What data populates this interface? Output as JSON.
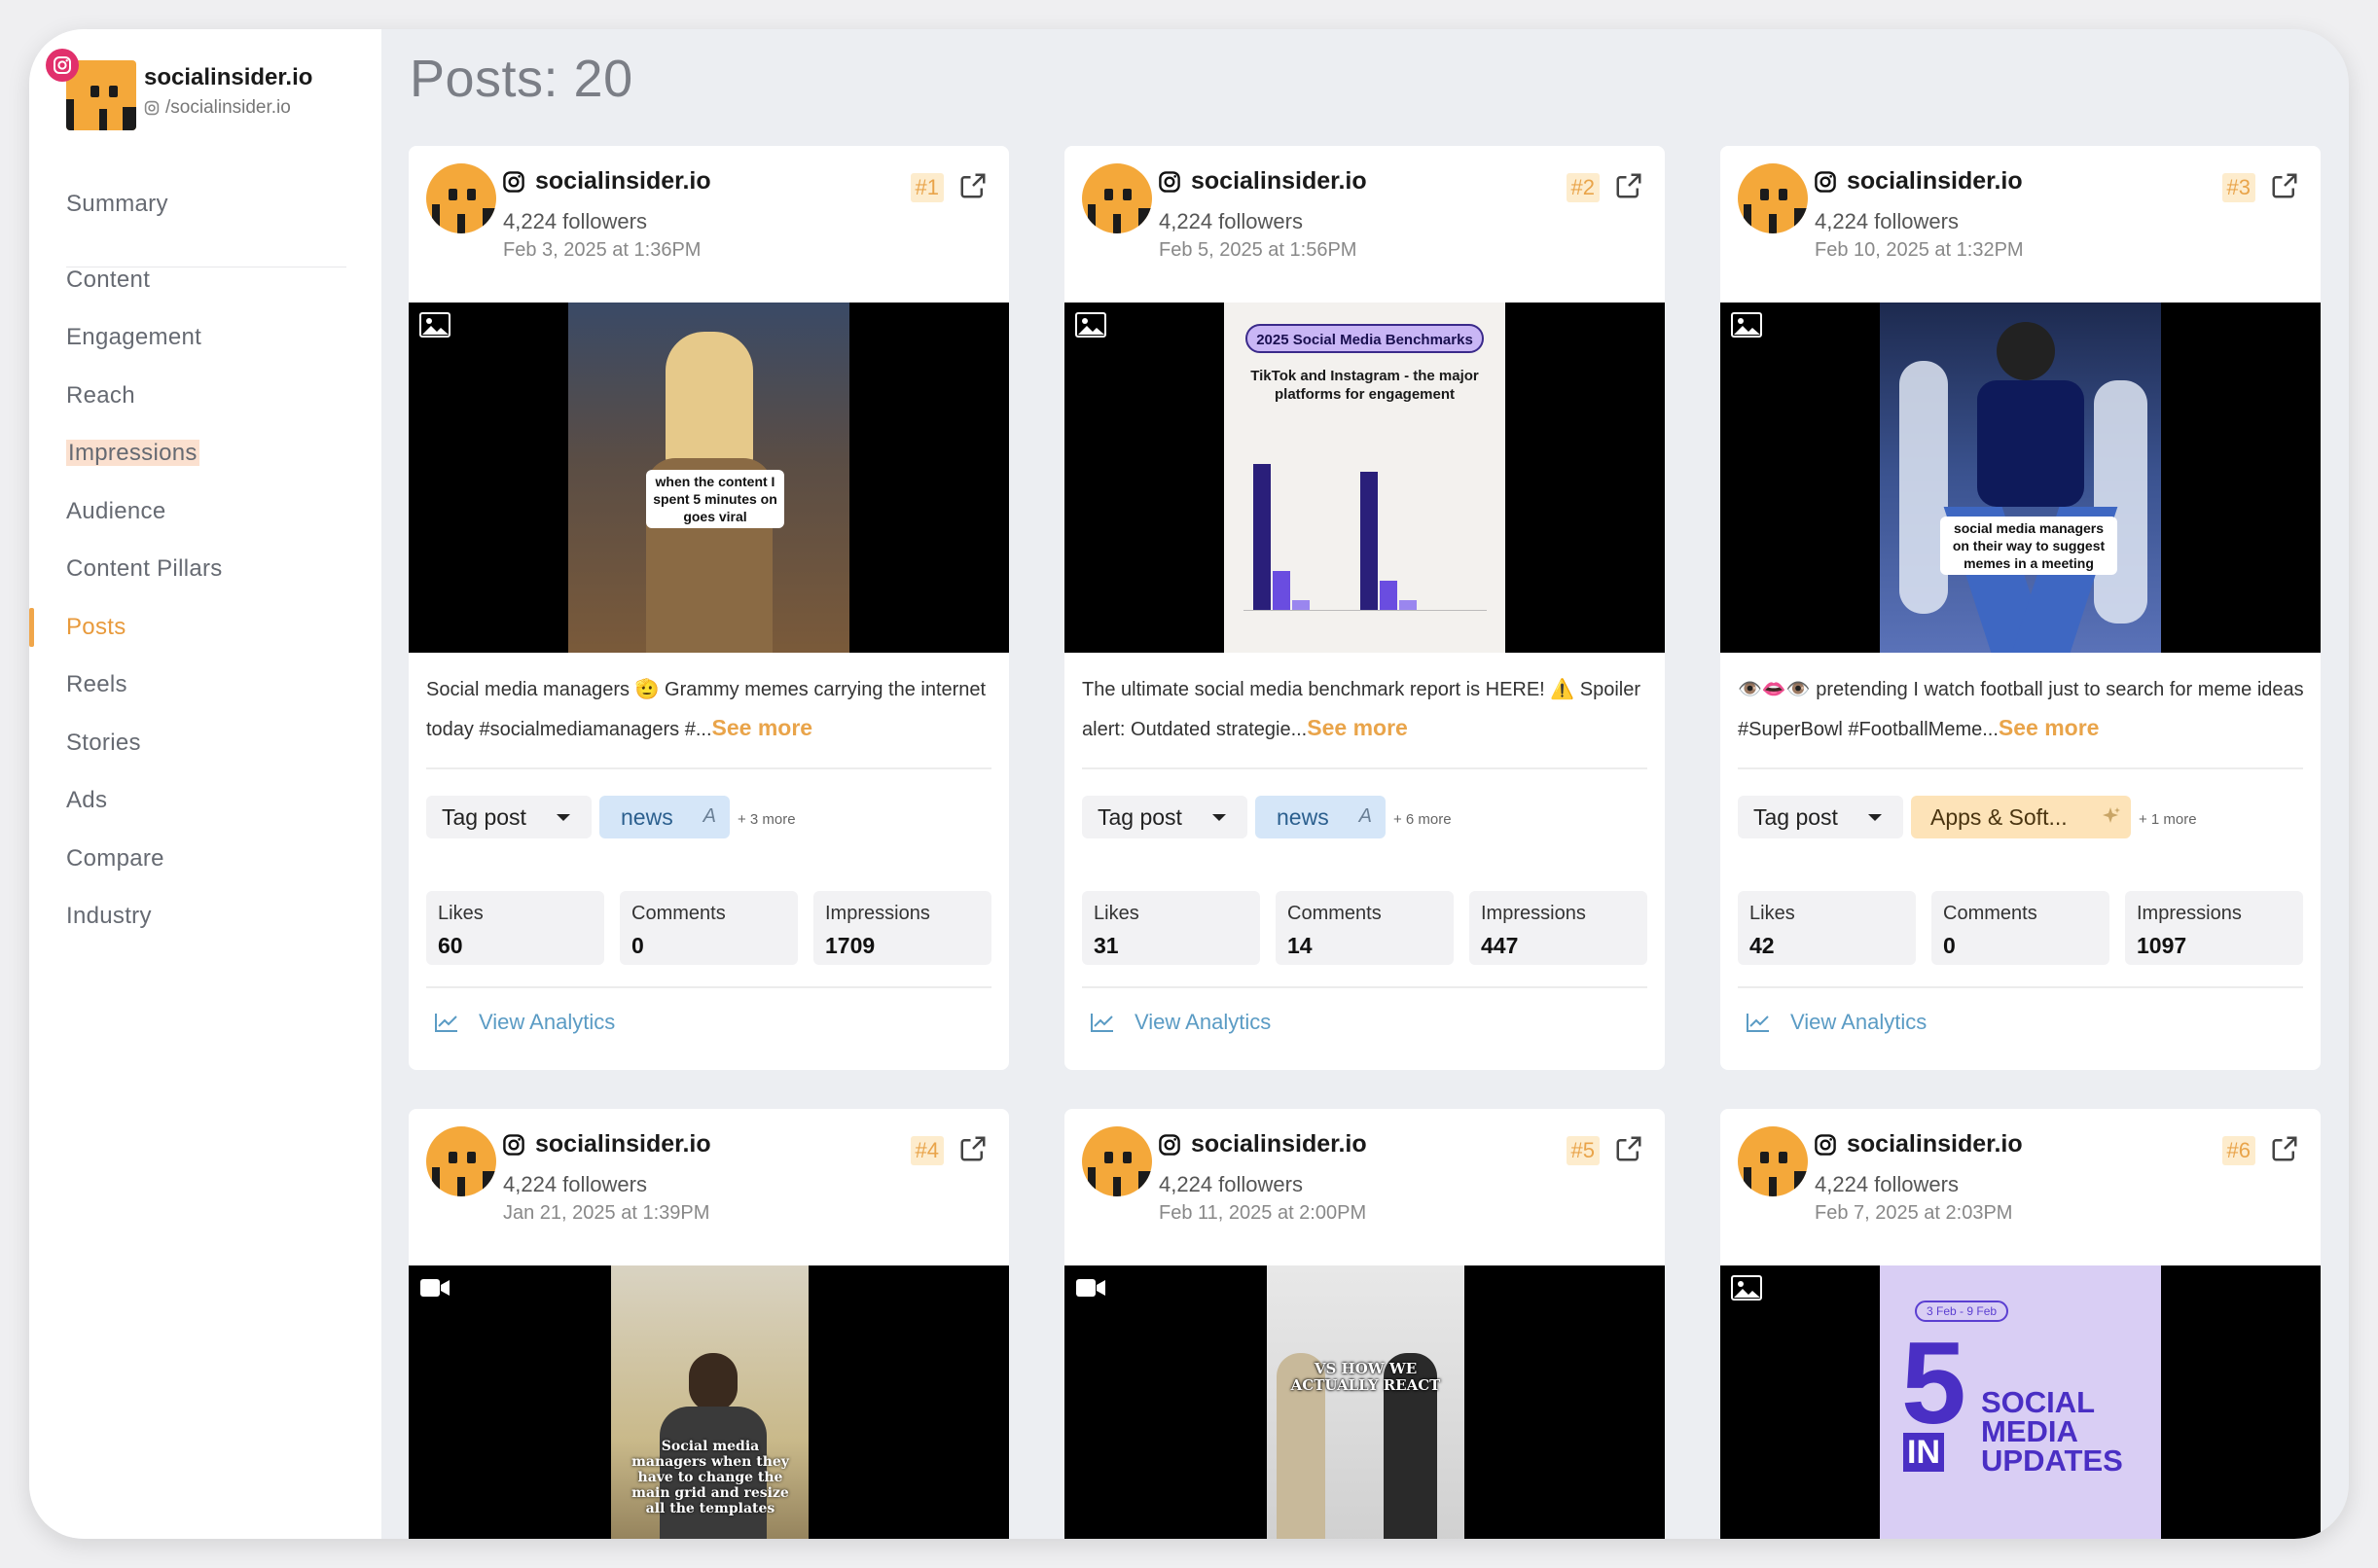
{
  "brand": {
    "name": "socialinsider.io",
    "handle": "/socialinsider.io"
  },
  "nav": [
    {
      "label": "Summary"
    },
    {
      "label": "Content"
    },
    {
      "label": "Engagement"
    },
    {
      "label": "Reach"
    },
    {
      "label": "Impressions"
    },
    {
      "label": "Audience"
    },
    {
      "label": "Content Pillars"
    },
    {
      "label": "Posts"
    },
    {
      "label": "Reels"
    },
    {
      "label": "Stories"
    },
    {
      "label": "Ads"
    },
    {
      "label": "Compare"
    },
    {
      "label": "Industry"
    }
  ],
  "page_title": "Posts: 20",
  "labels": {
    "tag_post": "Tag post",
    "likes": "Likes",
    "comments": "Comments",
    "impressions": "Impressions",
    "view_analytics": "View Analytics",
    "see_more": "See more"
  },
  "posts": [
    {
      "account": "socialinsider.io",
      "followers": "4,224 followers",
      "date": "Feb 3, 2025 at 1:36PM",
      "rank": "#1",
      "caption": "Social media managers 🫡 Grammy memes carrying the internet today #socialmediamanagers #...",
      "overlay_text": "when the content I spent 5 minutes on goes viral",
      "tag": "news",
      "tag_ai": "A",
      "more_tags": "+ 3 more",
      "likes": "60",
      "comments": "0",
      "impressions": "1709"
    },
    {
      "account": "socialinsider.io",
      "followers": "4,224 followers",
      "date": "Feb 5, 2025 at 1:56PM",
      "rank": "#2",
      "caption": "The ultimate social media benchmark report is HERE! ⚠️ Spoiler alert: Outdated strategie...",
      "overlay_title": "2025 Social Media Benchmarks",
      "overlay_subtitle": "TikTok and Instagram - the major platforms for engagement",
      "tag": "news",
      "tag_ai": "A",
      "more_tags": "+ 6 more",
      "likes": "31",
      "comments": "14",
      "impressions": "447"
    },
    {
      "account": "socialinsider.io",
      "followers": "4,224 followers",
      "date": "Feb 10, 2025 at 1:32PM",
      "rank": "#3",
      "caption": "👁️👄👁️ pretending I watch football just to search for meme ideas #SuperBowl #FootballMeme...",
      "overlay_text": "social media managers on their way to suggest memes in a meeting",
      "tag": "Apps & Soft...",
      "more_tags": "+ 1 more",
      "likes": "42",
      "comments": "0",
      "impressions": "1097"
    },
    {
      "account": "socialinsider.io",
      "followers": "4,224 followers",
      "date": "Jan 21, 2025 at 1:39PM",
      "rank": "#4",
      "overlay_text": "Social media managers when they have to change the main grid and resize all the templates"
    },
    {
      "account": "socialinsider.io",
      "followers": "4,224 followers",
      "date": "Feb 11, 2025 at 2:00PM",
      "rank": "#5",
      "overlay_text": "VS HOW WE ACTUALLY REACT"
    },
    {
      "account": "socialinsider.io",
      "followers": "4,224 followers",
      "date": "Feb 7, 2025 at 2:03PM",
      "rank": "#6",
      "overlay_date": "3 Feb - 9 Feb",
      "overlay_big": "5",
      "overlay_in": "IN",
      "overlay_title": "SOCIAL MEDIA UPDATES"
    }
  ],
  "colors": {
    "accent": "#e9a44a",
    "link": "#5a9bc4",
    "news_chip": "#d5e6f8",
    "apps_chip": "#fde3b8",
    "instagram": "#e1306c",
    "avatar": "#f4a83a"
  }
}
